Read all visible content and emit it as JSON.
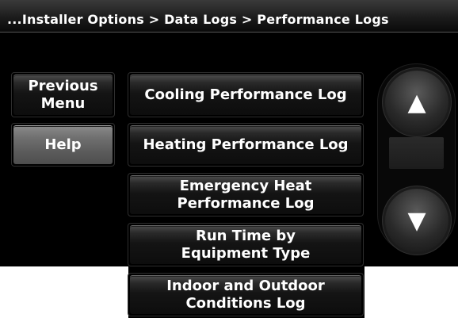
{
  "header": {
    "breadcrumb": "...Installer Options > Data Logs > Performance Logs"
  },
  "left_buttons": {
    "previous_menu_line1": "Previous",
    "previous_menu_line2": "Menu",
    "help": "Help"
  },
  "menu_items": [
    {
      "line1": "Cooling Performance Log",
      "line2": ""
    },
    {
      "line1": "Heating Performance Log",
      "line2": ""
    },
    {
      "line1": "Emergency Heat",
      "line2": "Performance Log"
    },
    {
      "line1": "Run Time by",
      "line2": "Equipment Type"
    },
    {
      "line1": "Indoor and Outdoor",
      "line2": "Conditions Log"
    }
  ],
  "scroll": {
    "up_icon": "▲",
    "down_icon": "▼"
  },
  "colors": {
    "screen_background": "#000000",
    "button_text": "#ffffff",
    "help_button": "#6a6a6a"
  }
}
